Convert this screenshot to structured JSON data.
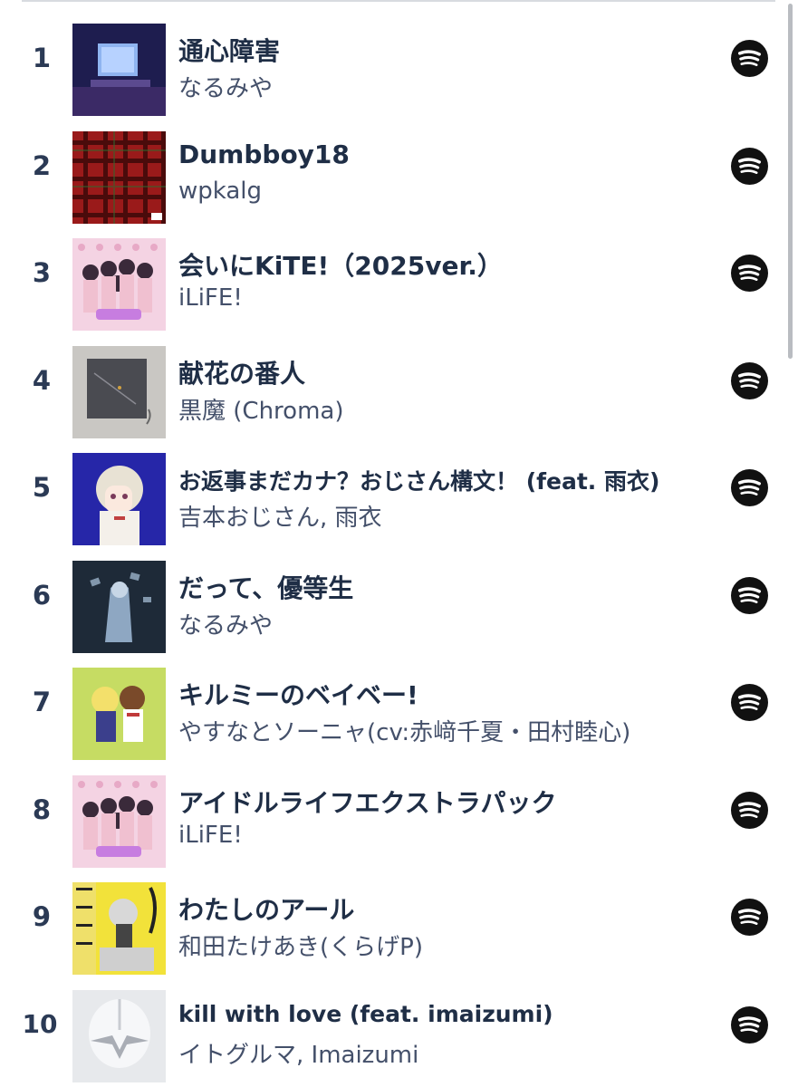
{
  "tracks": [
    {
      "rank": "1",
      "title": "通心障害",
      "artist": "なるみや",
      "service_icon": "spotify-icon"
    },
    {
      "rank": "2",
      "title": "Dumbboy18",
      "artist": "wpkalg",
      "service_icon": "spotify-icon"
    },
    {
      "rank": "3",
      "title": "会いにKiTE!（2025ver.）",
      "artist": "iLiFE!",
      "service_icon": "spotify-icon"
    },
    {
      "rank": "4",
      "title": "献花の番人",
      "artist": "黒魔 (Chroma)",
      "service_icon": "spotify-icon"
    },
    {
      "rank": "5",
      "title": "お返事まだカナ？おじさん構文！ (feat. 雨衣)",
      "artist": "吉本おじさん, 雨衣",
      "service_icon": "spotify-icon"
    },
    {
      "rank": "6",
      "title": "だって、優等生",
      "artist": "なるみや",
      "service_icon": "spotify-icon"
    },
    {
      "rank": "7",
      "title": "キルミーのベイベー!",
      "artist": "やすなとソーニャ(cv:赤﨑千夏・田村睦心)",
      "service_icon": "spotify-icon"
    },
    {
      "rank": "8",
      "title": "アイドルライフエクストラパック",
      "artist": "iLiFE!",
      "service_icon": "spotify-icon"
    },
    {
      "rank": "9",
      "title": "わたしのアール",
      "artist": "和田たけあき(くらげP)",
      "service_icon": "spotify-icon"
    },
    {
      "rank": "10",
      "title": "kill with love (feat. imaizumi)",
      "artist": "イトグルマ, Imaizumi",
      "service_icon": "spotify-icon"
    }
  ],
  "colors": {
    "text_primary": "#1f2e46",
    "text_secondary": "#44506a",
    "spotify": "#111111"
  }
}
